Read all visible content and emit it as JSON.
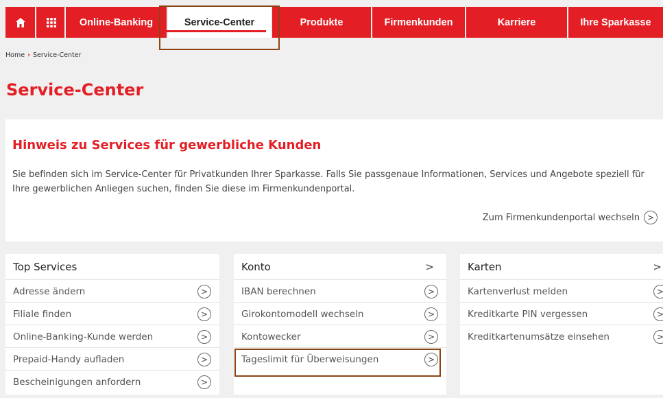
{
  "nav": {
    "home_icon": "home-icon",
    "grid_icon": "grid-menu-icon",
    "items": [
      {
        "label": "Online-Banking"
      },
      {
        "label": "Service-Center"
      },
      {
        "label": "Produkte"
      },
      {
        "label": "Firmenkunden"
      },
      {
        "label": "Karriere"
      },
      {
        "label": "Ihre Sparkasse"
      }
    ],
    "colors": {
      "brand": "#e31e24",
      "highlight": "#8b4513"
    }
  },
  "breadcrumb": {
    "home": "Home",
    "current": "Service-Center"
  },
  "page_title": "Service-Center",
  "notice": {
    "title": "Hinweis zu Services für gewerbliche Kunden",
    "text": "Sie befinden sich im Service-Center für Privatkunden Ihrer Sparkasse. Falls Sie passgenaue Informationen, Services und Angebote speziell für Ihre gewerblichen Anliegen suchen, finden Sie diese im Firmenkundenportal.",
    "link": "Zum Firmenkundenportal wechseln"
  },
  "cards": [
    {
      "title": "Top Services",
      "items": [
        "Adresse ändern",
        "Filiale finden",
        "Online-Banking-Kunde werden",
        "Prepaid-Handy aufladen",
        "Bescheinigungen anfordern"
      ]
    },
    {
      "title": "Konto",
      "items": [
        "IBAN berechnen",
        "Girokontomodell wechseln",
        "Kontowecker",
        "Tageslimit für Überweisungen"
      ]
    },
    {
      "title": "Karten",
      "items": [
        "Kartenverlust melden",
        "Kreditkarte PIN vergessen",
        "Kreditkartenumsätze einsehen"
      ]
    }
  ]
}
